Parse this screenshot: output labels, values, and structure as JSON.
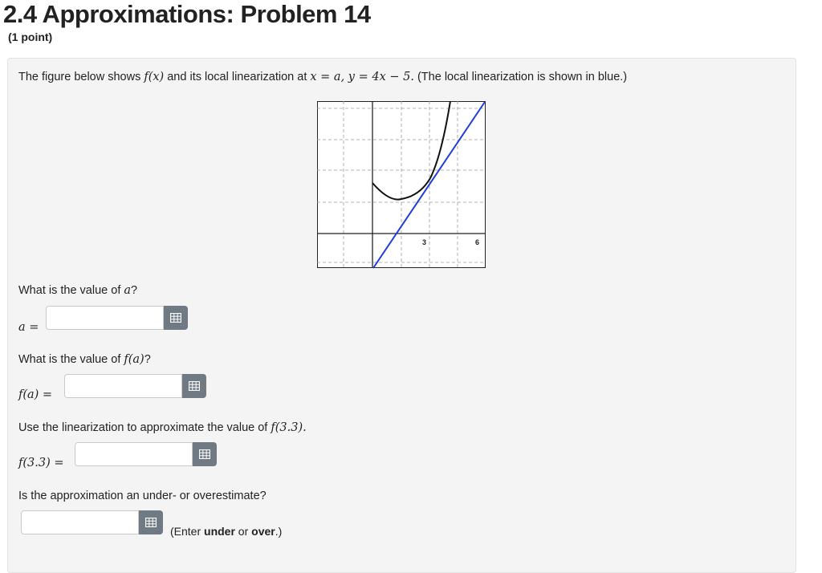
{
  "header": {
    "title": "2.4 Approximations: Problem 14",
    "points": "(1 point)"
  },
  "intro": {
    "prefix": "The figure below shows ",
    "fx": "f(x)",
    "middle": " and its local linearization at ",
    "at": "x = a, y = 4x − 5.",
    "suffix": " (The local linearization is shown in blue.)"
  },
  "graph": {
    "tick_labels": [
      "3",
      "6"
    ],
    "colors": {
      "function": "#111111",
      "linearization": "#1f3ed6",
      "grid": "#9a9a9a"
    }
  },
  "questions": [
    {
      "prompt_pre": "What is the value of ",
      "prompt_math": "a",
      "prompt_post": "?",
      "label": "a =",
      "value": "",
      "button_icon": "matrix-icon"
    },
    {
      "prompt_pre": "What is the value of ",
      "prompt_math": "f(a)",
      "prompt_post": "?",
      "label": "f(a) =",
      "value": "",
      "button_icon": "matrix-icon"
    },
    {
      "prompt_pre": "Use the linearization to approximate the value of ",
      "prompt_math": "f(3.3).",
      "prompt_post": "",
      "label": "f(3.3) =",
      "value": "",
      "button_icon": "matrix-icon"
    },
    {
      "prompt_pre": "Is the approximation an under- or overestimate?",
      "prompt_math": "",
      "prompt_post": "",
      "label": "",
      "value": "",
      "button_icon": "matrix-icon"
    }
  ],
  "hint": {
    "pre": "(Enter ",
    "b1": "under",
    "mid": " or ",
    "b2": "over",
    "post": ".)"
  }
}
